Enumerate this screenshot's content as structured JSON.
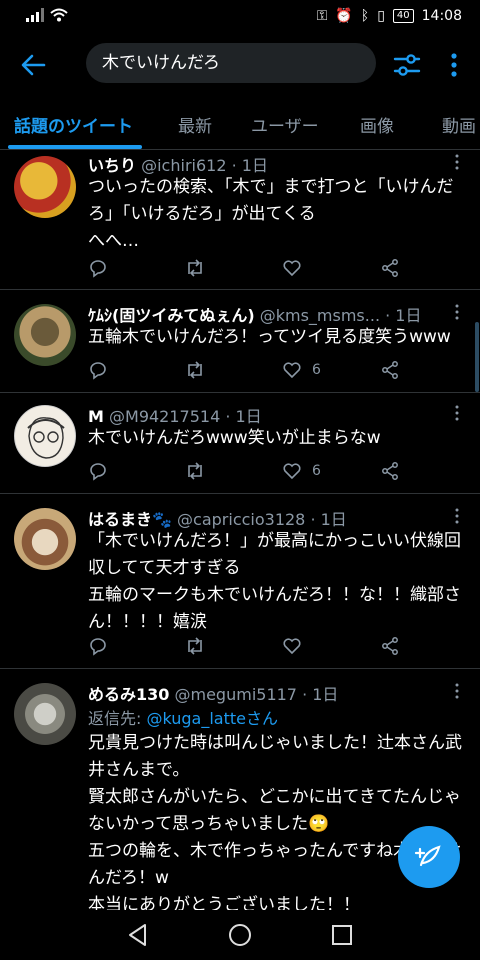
{
  "status_bar": {
    "battery": "40",
    "time": "14:08"
  },
  "search": {
    "query": "木でいけんだろ"
  },
  "tabs": [
    {
      "label": "話題のツイート",
      "active": true
    },
    {
      "label": "最新"
    },
    {
      "label": "ユーザー"
    },
    {
      "label": "画像"
    },
    {
      "label": "動画"
    }
  ],
  "tweets": [
    {
      "name": "いちり",
      "handle": "@ichiri612",
      "time": "1日",
      "body": "ついったの検索、「木で」まで打つと「いけんだろ」「いけるだろ」が出てくる\nへへ…",
      "likes": ""
    },
    {
      "name": "ｹﾑｼ(固ツイみてぬぇん)",
      "handle": "@kms_msms...",
      "time": "1日",
      "body": "五輪木でいけんだろ！ってツイ見る度笑うwww",
      "likes": "6"
    },
    {
      "name": "M",
      "handle": "@M94217514",
      "time": "1日",
      "body": "木でいけんだろwww笑いが止まらなw",
      "likes": "6"
    },
    {
      "name": "はるまき🐾",
      "handle": "@capriccio3128",
      "time": "1日",
      "body": "「木でいけんだろ！」が最高にかっこいい伏線回収してて天才すぎる\n五輪のマークも木でいけんだろ！！な！！織部さん！！！！嬉涙",
      "likes": ""
    },
    {
      "name": "めるみ130",
      "handle": "@megumi5117",
      "time": "1日",
      "reply_prefix": "返信先: ",
      "reply_target": "@kuga_latteさん",
      "body": "兄貴見つけた時は叫んじゃいました！辻本さん武井さんまで。\n賢太郎さんがいたら、どこかに出てきてたんじゃないかって思っちゃいました🙄\n五つの輪を、木で作っちゃったんですね木でいけんだろ！w\n本当にありがとうございました！！",
      "likes": ""
    }
  ],
  "colors": {
    "accent": "#1d9bf0",
    "background": "#000000",
    "muted": "#8b98a5",
    "divider": "#2f3336"
  },
  "icons": [
    "back-arrow-icon",
    "filter-icon",
    "more-vert-icon",
    "reply-icon",
    "retweet-icon",
    "like-icon",
    "share-icon",
    "compose-icon"
  ]
}
